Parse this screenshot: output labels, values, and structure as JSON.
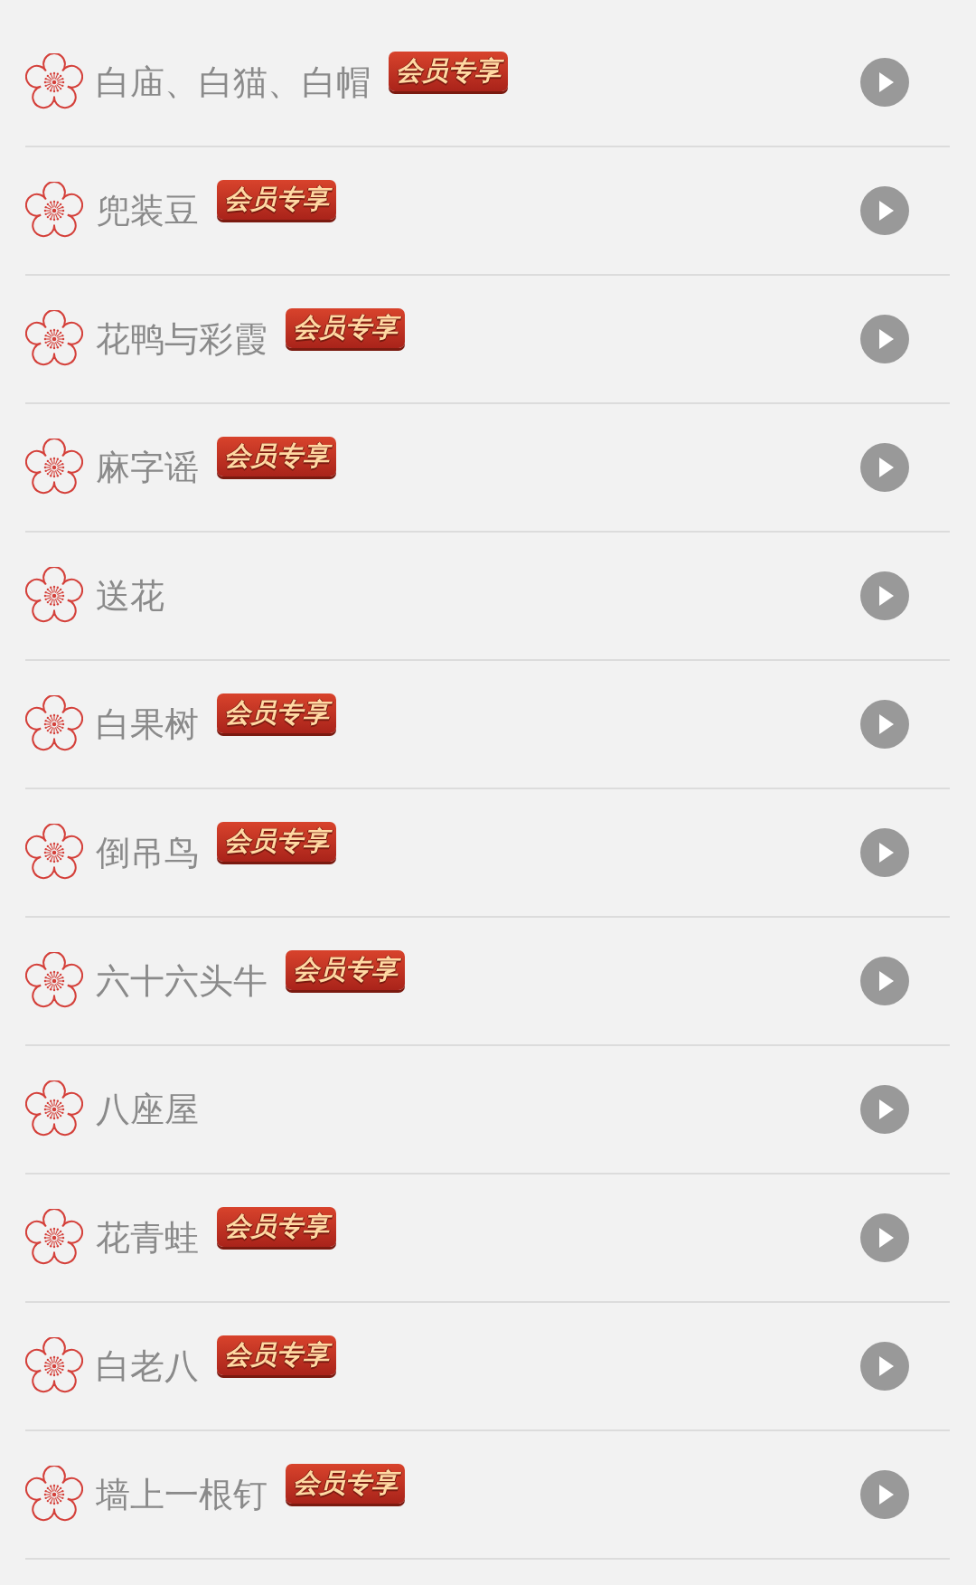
{
  "songs": [
    {
      "title": "白庙、白猫、白帽",
      "badge": "会员专享"
    },
    {
      "title": "兜装豆",
      "badge": "会员专享"
    },
    {
      "title": "花鸭与彩霞",
      "badge": "会员专享"
    },
    {
      "title": "麻字谣",
      "badge": "会员专享"
    },
    {
      "title": "送花"
    },
    {
      "title": "白果树",
      "badge": "会员专享"
    },
    {
      "title": "倒吊鸟",
      "badge": "会员专享"
    },
    {
      "title": "六十六头牛",
      "badge": "会员专享"
    },
    {
      "title": "八座屋"
    },
    {
      "title": "花青蛙",
      "badge": "会员专享"
    },
    {
      "title": "白老八",
      "badge": "会员专享"
    },
    {
      "title": "墙上一根钉",
      "badge": "会员专享"
    }
  ]
}
